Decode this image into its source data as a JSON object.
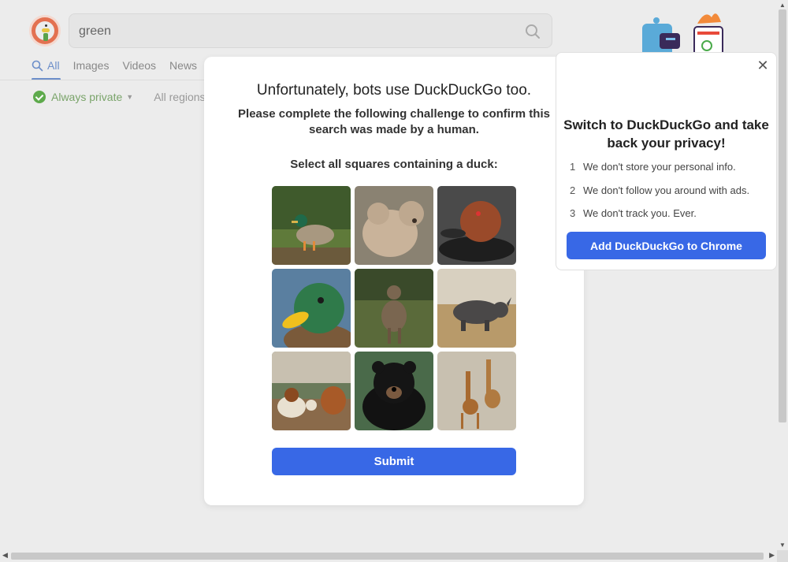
{
  "search": {
    "query": "green"
  },
  "tabs": [
    "All",
    "Images",
    "Videos",
    "News"
  ],
  "filters": {
    "privacy": "Always private",
    "region": "All regions"
  },
  "challenge": {
    "title": "Unfortunately, bots use DuckDuckGo too.",
    "subtitle": "Please complete the following challenge to confirm this search was made by a human.",
    "instruction": "Select all squares containing a duck:",
    "tiles": [
      "mallard duck",
      "bear",
      "red-headed duck",
      "mallard duck head",
      "deer",
      "rhinoceros",
      "dogs",
      "black bear",
      "giraffes"
    ],
    "submit_label": "Submit"
  },
  "promo": {
    "title": "Switch to DuckDuckGo and take back your privacy!",
    "points": [
      {
        "num": "1",
        "text": "We don't store your personal info."
      },
      {
        "num": "2",
        "text": "We don't follow you around with ads."
      },
      {
        "num": "3",
        "text": "We don't track you. Ever."
      }
    ],
    "button_label": "Add DuckDuckGo to Chrome",
    "close_label": "✕"
  },
  "colors": {
    "accent": "#3868e6",
    "tab_active": "#6c8ec9",
    "private_green": "#5eaa4c"
  }
}
